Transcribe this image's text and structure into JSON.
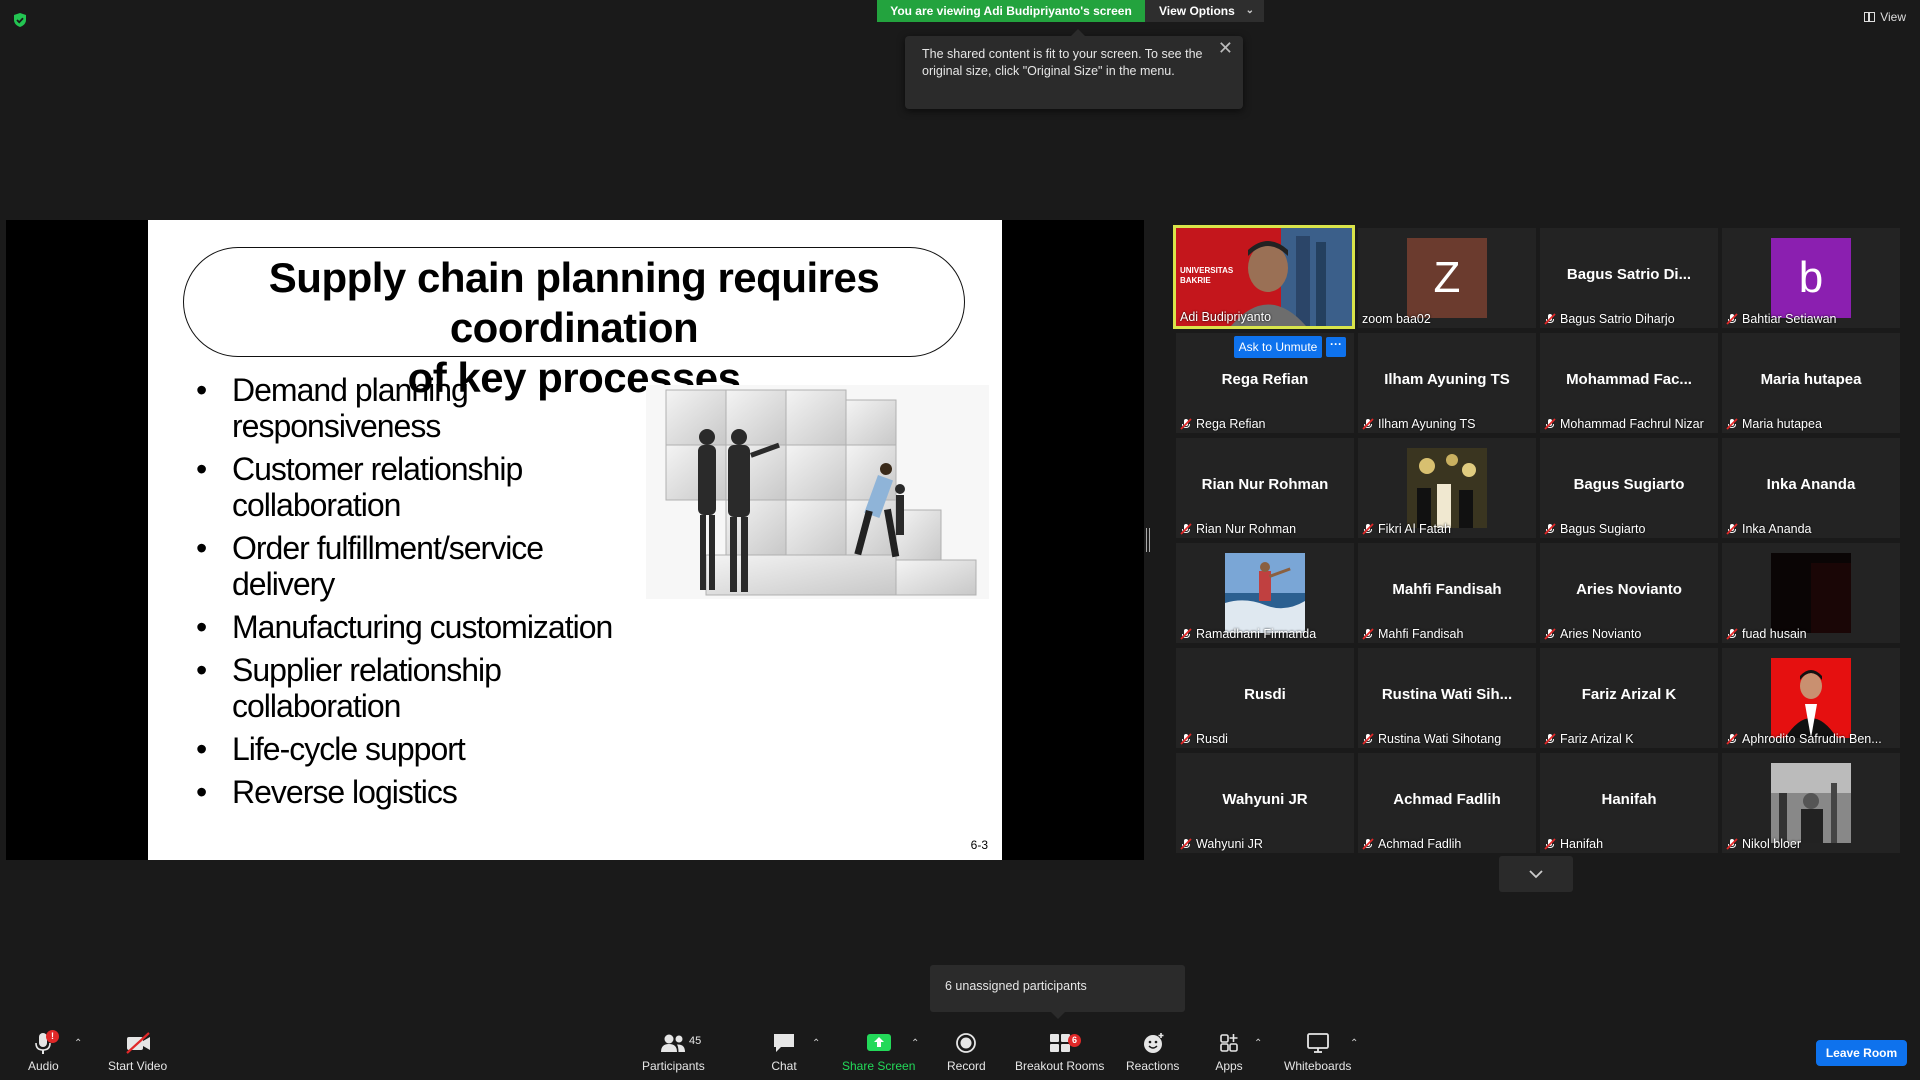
{
  "top": {
    "viewing_banner": "You are viewing Adi Budipriyanto's screen",
    "view_options": "View Options",
    "view_label": "View"
  },
  "tooltip": {
    "text": "The shared content is fit to your screen. To see the original size, click \"Original Size\" in the menu."
  },
  "slide": {
    "title_line1": "Supply chain planning requires coordination",
    "title_line2": "of key processes",
    "bullets": [
      "Demand planning responsiveness",
      "Customer relationship collaboration",
      "Order fulfillment/service delivery",
      "Manufacturing customization",
      "Supplier relationship collaboration",
      "Life-cycle support",
      "Reverse logistics"
    ],
    "page_number": "6-3"
  },
  "gallery": {
    "active_speaker": {
      "name": "Adi Budipriyanto",
      "banner_line1": "UNIVERSITAS",
      "banner_line2": "BAKRIE"
    },
    "tiles": [
      {
        "big": "",
        "small": "zoom baa02",
        "avatar": "Z",
        "avatar_color": "#6b3b2e",
        "muted": false
      },
      {
        "big": "Bagus Satrio Di...",
        "small": "Bagus Satrio Diharjo",
        "muted": true
      },
      {
        "big": "",
        "small": "Bahtiar Setiawan",
        "avatar": "b",
        "avatar_color": "#8b1fb0",
        "muted": true
      },
      {
        "big": "Rega Refian",
        "small": "Rega Refian",
        "muted": true
      },
      {
        "big": "Ilham Ayuning TS",
        "small": "Ilham Ayuning TS",
        "muted": true
      },
      {
        "big": "Mohammad Fac...",
        "small": "Mohammad Fachrul Nizar",
        "muted": true
      },
      {
        "big": "Maria hutapea",
        "small": "Maria hutapea",
        "muted": true
      },
      {
        "big": "Rian Nur Rohman",
        "small": "Rian Nur Rohman",
        "muted": true
      },
      {
        "big": "",
        "small": "Fikri Al Fatah",
        "photo": "party",
        "muted": true
      },
      {
        "big": "Bagus Sugiarto",
        "small": "Bagus Sugiarto",
        "muted": true
      },
      {
        "big": "Inka Ananda",
        "small": "Inka Ananda",
        "muted": true
      },
      {
        "big": "",
        "small": "Ramadhani Firmanda",
        "photo": "sea",
        "muted": true
      },
      {
        "big": "Mahfi Fandisah",
        "small": "Mahfi Fandisah",
        "muted": true
      },
      {
        "big": "Aries Novianto",
        "small": "Aries Novianto",
        "muted": true
      },
      {
        "big": "",
        "small": "fuad husain",
        "photo": "dark",
        "muted": true
      },
      {
        "big": "Rusdi",
        "small": "Rusdi",
        "muted": true
      },
      {
        "big": "Rustina Wati Sih...",
        "small": "Rustina Wati Sihotang",
        "muted": true
      },
      {
        "big": "Fariz Arizal K",
        "small": "Fariz Arizal K",
        "muted": true
      },
      {
        "big": "",
        "small": "Aphrodito Safrudin Ben...",
        "photo": "red",
        "muted": true
      },
      {
        "big": "Wahyuni JR",
        "small": "Wahyuni JR",
        "muted": true
      },
      {
        "big": "Achmad Fadlih",
        "small": "Achmad Fadlih",
        "muted": true
      },
      {
        "big": "Hanifah",
        "small": "Hanifah",
        "muted": true
      },
      {
        "big": "",
        "small": "Nikol bloer",
        "photo": "bw",
        "muted": true
      }
    ],
    "ask_unmute": "Ask to Unmute",
    "more": "···"
  },
  "unassigned": "6 unassigned participants",
  "toolbar": {
    "audio": "Audio",
    "audio_badge": "!",
    "start_video": "Start Video",
    "participants": "Participants",
    "participants_count": "45",
    "chat": "Chat",
    "share_screen": "Share Screen",
    "record": "Record",
    "breakout_rooms": "Breakout Rooms",
    "breakout_badge": "6",
    "reactions": "Reactions",
    "apps": "Apps",
    "whiteboards": "Whiteboards",
    "leave": "Leave Room"
  },
  "colors": {
    "banner_green": "#23a33e",
    "accent_blue": "#0e72ed",
    "share_green": "#23d959",
    "mute_red": "#e02828",
    "active_border": "#d9e44a"
  }
}
